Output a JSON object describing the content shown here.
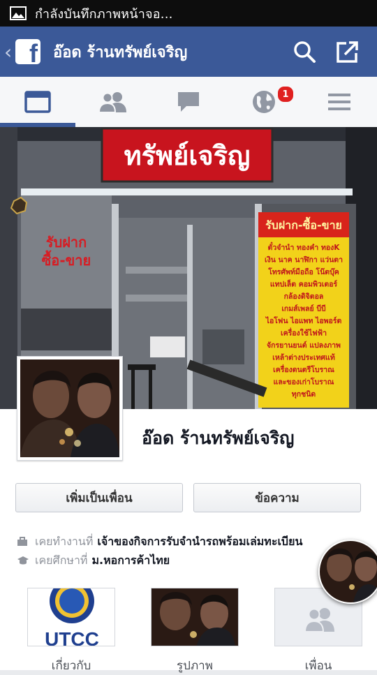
{
  "status_bar": {
    "text": "กำลังบันทึกภาพหน้าจอ..."
  },
  "app_bar": {
    "logo": "f",
    "title": "อ๊อด ร้านทรัพย์เจริญ"
  },
  "tabs": [
    {
      "name": "news-feed",
      "icon": "news-feed-icon",
      "active": true
    },
    {
      "name": "friend-requests",
      "icon": "friends-icon",
      "active": false
    },
    {
      "name": "messages",
      "icon": "chat-icon",
      "active": false
    },
    {
      "name": "notifications",
      "icon": "globe-icon",
      "active": false,
      "badge": "1"
    },
    {
      "name": "more",
      "icon": "menu-icon",
      "active": false
    }
  ],
  "cover": {
    "store_sign": "ทรัพย์เจริญ",
    "window_text_1": "รับฝาก",
    "window_text_2": "ซื้อ-ขาย",
    "banner_title": "รับฝาก-ซื้อ-ขาย",
    "banner_lines": [
      "ตั๋วจำนำ ทองคำ ทองK",
      "เงิน นาค นาฬิกา แว่นตา",
      "โทรศัพท์มือถือ โน๊ตบุ๊ค",
      "แทปเล็ต คอมพิวเตอร์",
      "กล้องดิจิตอล",
      "เกมส์เพลย์ บีบี",
      "ไอโฟน ไอแพท ไอพอร์ต",
      "เครื่องใช้ไฟฟ้า",
      "จักรยานยนต์ แปลงภาพ",
      "เหล้าต่างประเทศแท้",
      "เครื่องดนตรีโบราณ",
      "และของเก่าโบราณ",
      "ทุกชนิด"
    ]
  },
  "profile": {
    "name": "อ๊อด ร้านทรัพย์เจริญ",
    "add_friend_label": "เพิ่มเป็นเพื่อน",
    "message_label": "ข้อความ",
    "work_prefix": "เคยทำงานที่",
    "work_value": "เจ้าของกิจการรับจำนำรถพร้อมเล่มทะเบียน",
    "study_prefix": "เคยศึกษาที่",
    "study_value": "ม.หอการค้าไทย"
  },
  "sections": {
    "about_label": "เกี่ยวกับ",
    "about_thumb_text": "UTCC",
    "photos_label": "รูปภาพ",
    "friends_label": "เพื่อน"
  },
  "colors": {
    "brand": "#3b5998",
    "badge": "#e02020",
    "sign_red": "#c8141e",
    "banner_yellow": "#f2d21a"
  }
}
